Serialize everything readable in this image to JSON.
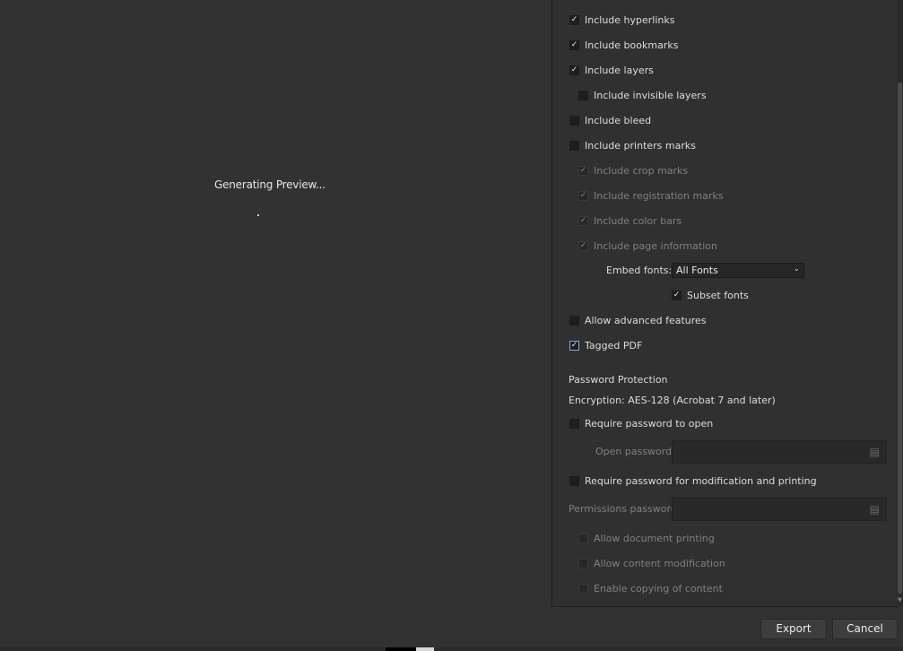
{
  "preview": {
    "status": "Generating Preview..."
  },
  "options": {
    "include_hyperlinks": {
      "label": "Include hyperlinks",
      "checked": true
    },
    "include_bookmarks": {
      "label": "Include bookmarks",
      "checked": true
    },
    "include_layers": {
      "label": "Include layers",
      "checked": true
    },
    "include_invisible_layers": {
      "label": "Include invisible layers",
      "checked": false
    },
    "include_bleed": {
      "label": "Include bleed",
      "checked": false
    },
    "include_printers_marks": {
      "label": "Include printers marks",
      "checked": false
    },
    "include_crop_marks": {
      "label": "Include crop marks",
      "checked": true,
      "disabled": true
    },
    "include_registration_marks": {
      "label": "Include registration marks",
      "checked": true,
      "disabled": true
    },
    "include_color_bars": {
      "label": "Include color bars",
      "checked": true,
      "disabled": true
    },
    "include_page_information": {
      "label": "Include page information",
      "checked": true,
      "disabled": true
    },
    "embed_fonts": {
      "label": "Embed fonts:",
      "value": "All Fonts"
    },
    "subset_fonts": {
      "label": "Subset fonts",
      "checked": true
    },
    "allow_advanced_features": {
      "label": "Allow advanced features",
      "checked": false
    },
    "tagged_pdf": {
      "label": "Tagged PDF",
      "checked": true
    }
  },
  "password": {
    "section_title": "Password Protection",
    "encryption": "Encryption: AES-128 (Acrobat 7 and later)",
    "require_open": {
      "label": "Require password to open",
      "checked": false
    },
    "open_password_label": "Open password",
    "require_modify": {
      "label": "Require password for modification and printing",
      "checked": false
    },
    "permissions_password_label": "Permissions password",
    "allow_printing": {
      "label": "Allow document printing",
      "checked": false,
      "disabled": true
    },
    "allow_modification": {
      "label": "Allow content modification",
      "checked": false,
      "disabled": true
    },
    "enable_copying": {
      "label": "Enable copying of content",
      "checked": false,
      "disabled": true
    }
  },
  "buttons": {
    "export": "Export",
    "cancel": "Cancel"
  }
}
